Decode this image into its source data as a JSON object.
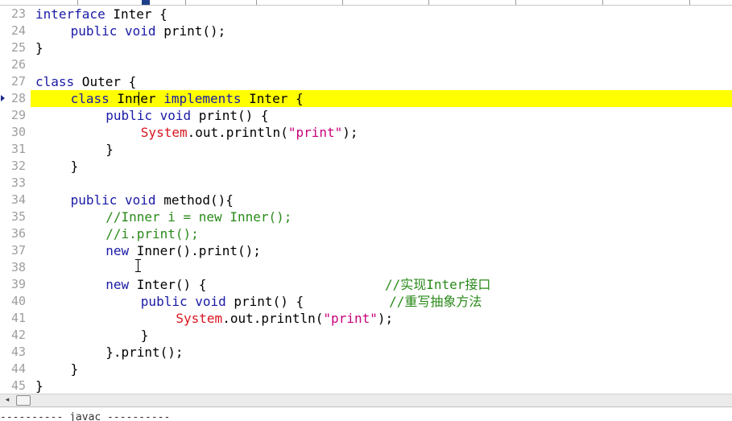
{
  "editor": {
    "current_line": "28",
    "lines": [
      {
        "num": "23",
        "indent": 0,
        "tokens": [
          {
            "t": "interface",
            "c": "kw"
          },
          {
            "t": " Inter {",
            "c": ""
          }
        ]
      },
      {
        "num": "24",
        "indent": 1,
        "tokens": [
          {
            "t": "public",
            "c": "kw"
          },
          {
            "t": " ",
            "c": ""
          },
          {
            "t": "void",
            "c": "kw"
          },
          {
            "t": " print();",
            "c": ""
          }
        ]
      },
      {
        "num": "25",
        "indent": 0,
        "tokens": [
          {
            "t": "}",
            "c": ""
          }
        ]
      },
      {
        "num": "26",
        "indent": 0,
        "tokens": []
      },
      {
        "num": "27",
        "indent": 0,
        "tokens": [
          {
            "t": "class",
            "c": "kw"
          },
          {
            "t": " Outer {",
            "c": ""
          }
        ]
      },
      {
        "num": "28",
        "indent": 1,
        "tokens": [
          {
            "t": "class",
            "c": "kw"
          },
          {
            "t": " Inner ",
            "c": ""
          },
          {
            "t": "implements",
            "c": "kw"
          },
          {
            "t": " Inter {",
            "c": ""
          }
        ]
      },
      {
        "num": "29",
        "indent": 2,
        "tokens": [
          {
            "t": "public",
            "c": "kw"
          },
          {
            "t": " ",
            "c": ""
          },
          {
            "t": "void",
            "c": "kw"
          },
          {
            "t": " print() {",
            "c": ""
          }
        ]
      },
      {
        "num": "30",
        "indent": 3,
        "tokens": [
          {
            "t": "System",
            "c": "sys"
          },
          {
            "t": ".out.println(",
            "c": ""
          },
          {
            "t": "\"print\"",
            "c": "str"
          },
          {
            "t": ");",
            "c": ""
          }
        ]
      },
      {
        "num": "31",
        "indent": 2,
        "tokens": [
          {
            "t": "}",
            "c": ""
          }
        ]
      },
      {
        "num": "32",
        "indent": 1,
        "tokens": [
          {
            "t": "}",
            "c": ""
          }
        ]
      },
      {
        "num": "33",
        "indent": 0,
        "tokens": []
      },
      {
        "num": "34",
        "indent": 1,
        "tokens": [
          {
            "t": "public",
            "c": "kw"
          },
          {
            "t": " ",
            "c": ""
          },
          {
            "t": "void",
            "c": "kw"
          },
          {
            "t": " method(){",
            "c": ""
          }
        ]
      },
      {
        "num": "35",
        "indent": 2,
        "tokens": [
          {
            "t": "//Inner i = new Inner();",
            "c": "cmt"
          }
        ]
      },
      {
        "num": "36",
        "indent": 2,
        "tokens": [
          {
            "t": "//i.print();",
            "c": "cmt"
          }
        ]
      },
      {
        "num": "37",
        "indent": 2,
        "tokens": [
          {
            "t": "new",
            "c": "kw"
          },
          {
            "t": " Inner().print();",
            "c": ""
          }
        ]
      },
      {
        "num": "38",
        "indent": 0,
        "tokens": []
      },
      {
        "num": "39",
        "indent": 2,
        "tokens": [
          {
            "t": "new",
            "c": "kw"
          },
          {
            "t": " Inter() {                       ",
            "c": ""
          },
          {
            "t": "//实现Inter接口",
            "c": "cmt"
          }
        ]
      },
      {
        "num": "40",
        "indent": 3,
        "tokens": [
          {
            "t": "public",
            "c": "kw"
          },
          {
            "t": " ",
            "c": ""
          },
          {
            "t": "void",
            "c": "kw"
          },
          {
            "t": " print() {           ",
            "c": ""
          },
          {
            "t": "//重写抽象方法",
            "c": "cmt"
          }
        ]
      },
      {
        "num": "41",
        "indent": 4,
        "tokens": [
          {
            "t": "System",
            "c": "sys"
          },
          {
            "t": ".out.println(",
            "c": ""
          },
          {
            "t": "\"print\"",
            "c": "str"
          },
          {
            "t": ");",
            "c": ""
          }
        ]
      },
      {
        "num": "42",
        "indent": 3,
        "tokens": [
          {
            "t": "}",
            "c": ""
          }
        ]
      },
      {
        "num": "43",
        "indent": 2,
        "tokens": [
          {
            "t": "}.print();",
            "c": ""
          }
        ]
      },
      {
        "num": "44",
        "indent": 1,
        "tokens": [
          {
            "t": "}",
            "c": ""
          }
        ]
      },
      {
        "num": "45",
        "indent": 0,
        "tokens": [
          {
            "t": "}",
            "c": ""
          }
        ]
      }
    ]
  },
  "scrollbar": {
    "left_arrow": "◂"
  },
  "output": {
    "title": "---------- javac ----------"
  },
  "colors": {
    "keyword": "#1a1aa6",
    "string": "#c8007a",
    "system_class": "#d8141e",
    "comment": "#2a8a1a",
    "current_line_highlight": "#ffff00",
    "line_number": "#9e9e9e"
  }
}
